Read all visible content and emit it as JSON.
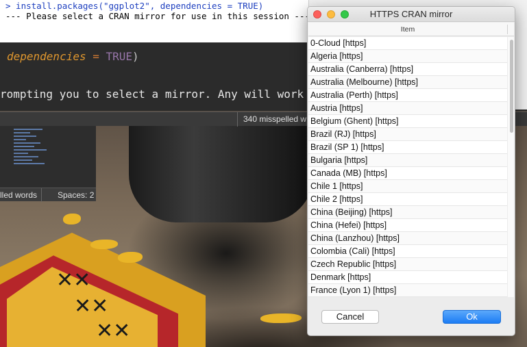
{
  "console": {
    "line1": "> install.packages(\"ggplot2\", dependencies = TRUE)",
    "line2": "--- Please select a CRAN mirror for use in this session ---"
  },
  "editor": {
    "arg": "dependencies",
    "op": " = ",
    "bool": "TRUE",
    "paren": ")",
    "line2": "rompting you to select a mirror. Any will work — I"
  },
  "statusbar": {
    "misspelled": "340 misspelled w"
  },
  "thumb": {
    "misspelled": "lled words",
    "spaces": "Spaces: 2"
  },
  "dialog": {
    "title": "HTTPS CRAN mirror",
    "column_header": "Item",
    "items": [
      "0-Cloud [https]",
      "Algeria [https]",
      "Australia (Canberra) [https]",
      "Australia (Melbourne) [https]",
      "Australia (Perth) [https]",
      "Austria [https]",
      "Belgium (Ghent) [https]",
      "Brazil (RJ) [https]",
      "Brazil (SP 1) [https]",
      "Bulgaria [https]",
      "Canada (MB) [https]",
      "Chile 1 [https]",
      "Chile 2 [https]",
      "China (Beijing) [https]",
      "China (Hefei) [https]",
      "China (Lanzhou) [https]",
      "Colombia (Cali) [https]",
      "Czech Republic [https]",
      "Denmark [https]",
      "France (Lyon 1) [https]"
    ],
    "cancel_label": "Cancel",
    "ok_label": "Ok"
  },
  "colors": {
    "ok_button": "#1c7cf4",
    "close_light": "#fc605c",
    "minimize_light": "#fdbc40",
    "zoom_light": "#34c84a",
    "console_prompt": "#1d3fbf"
  }
}
